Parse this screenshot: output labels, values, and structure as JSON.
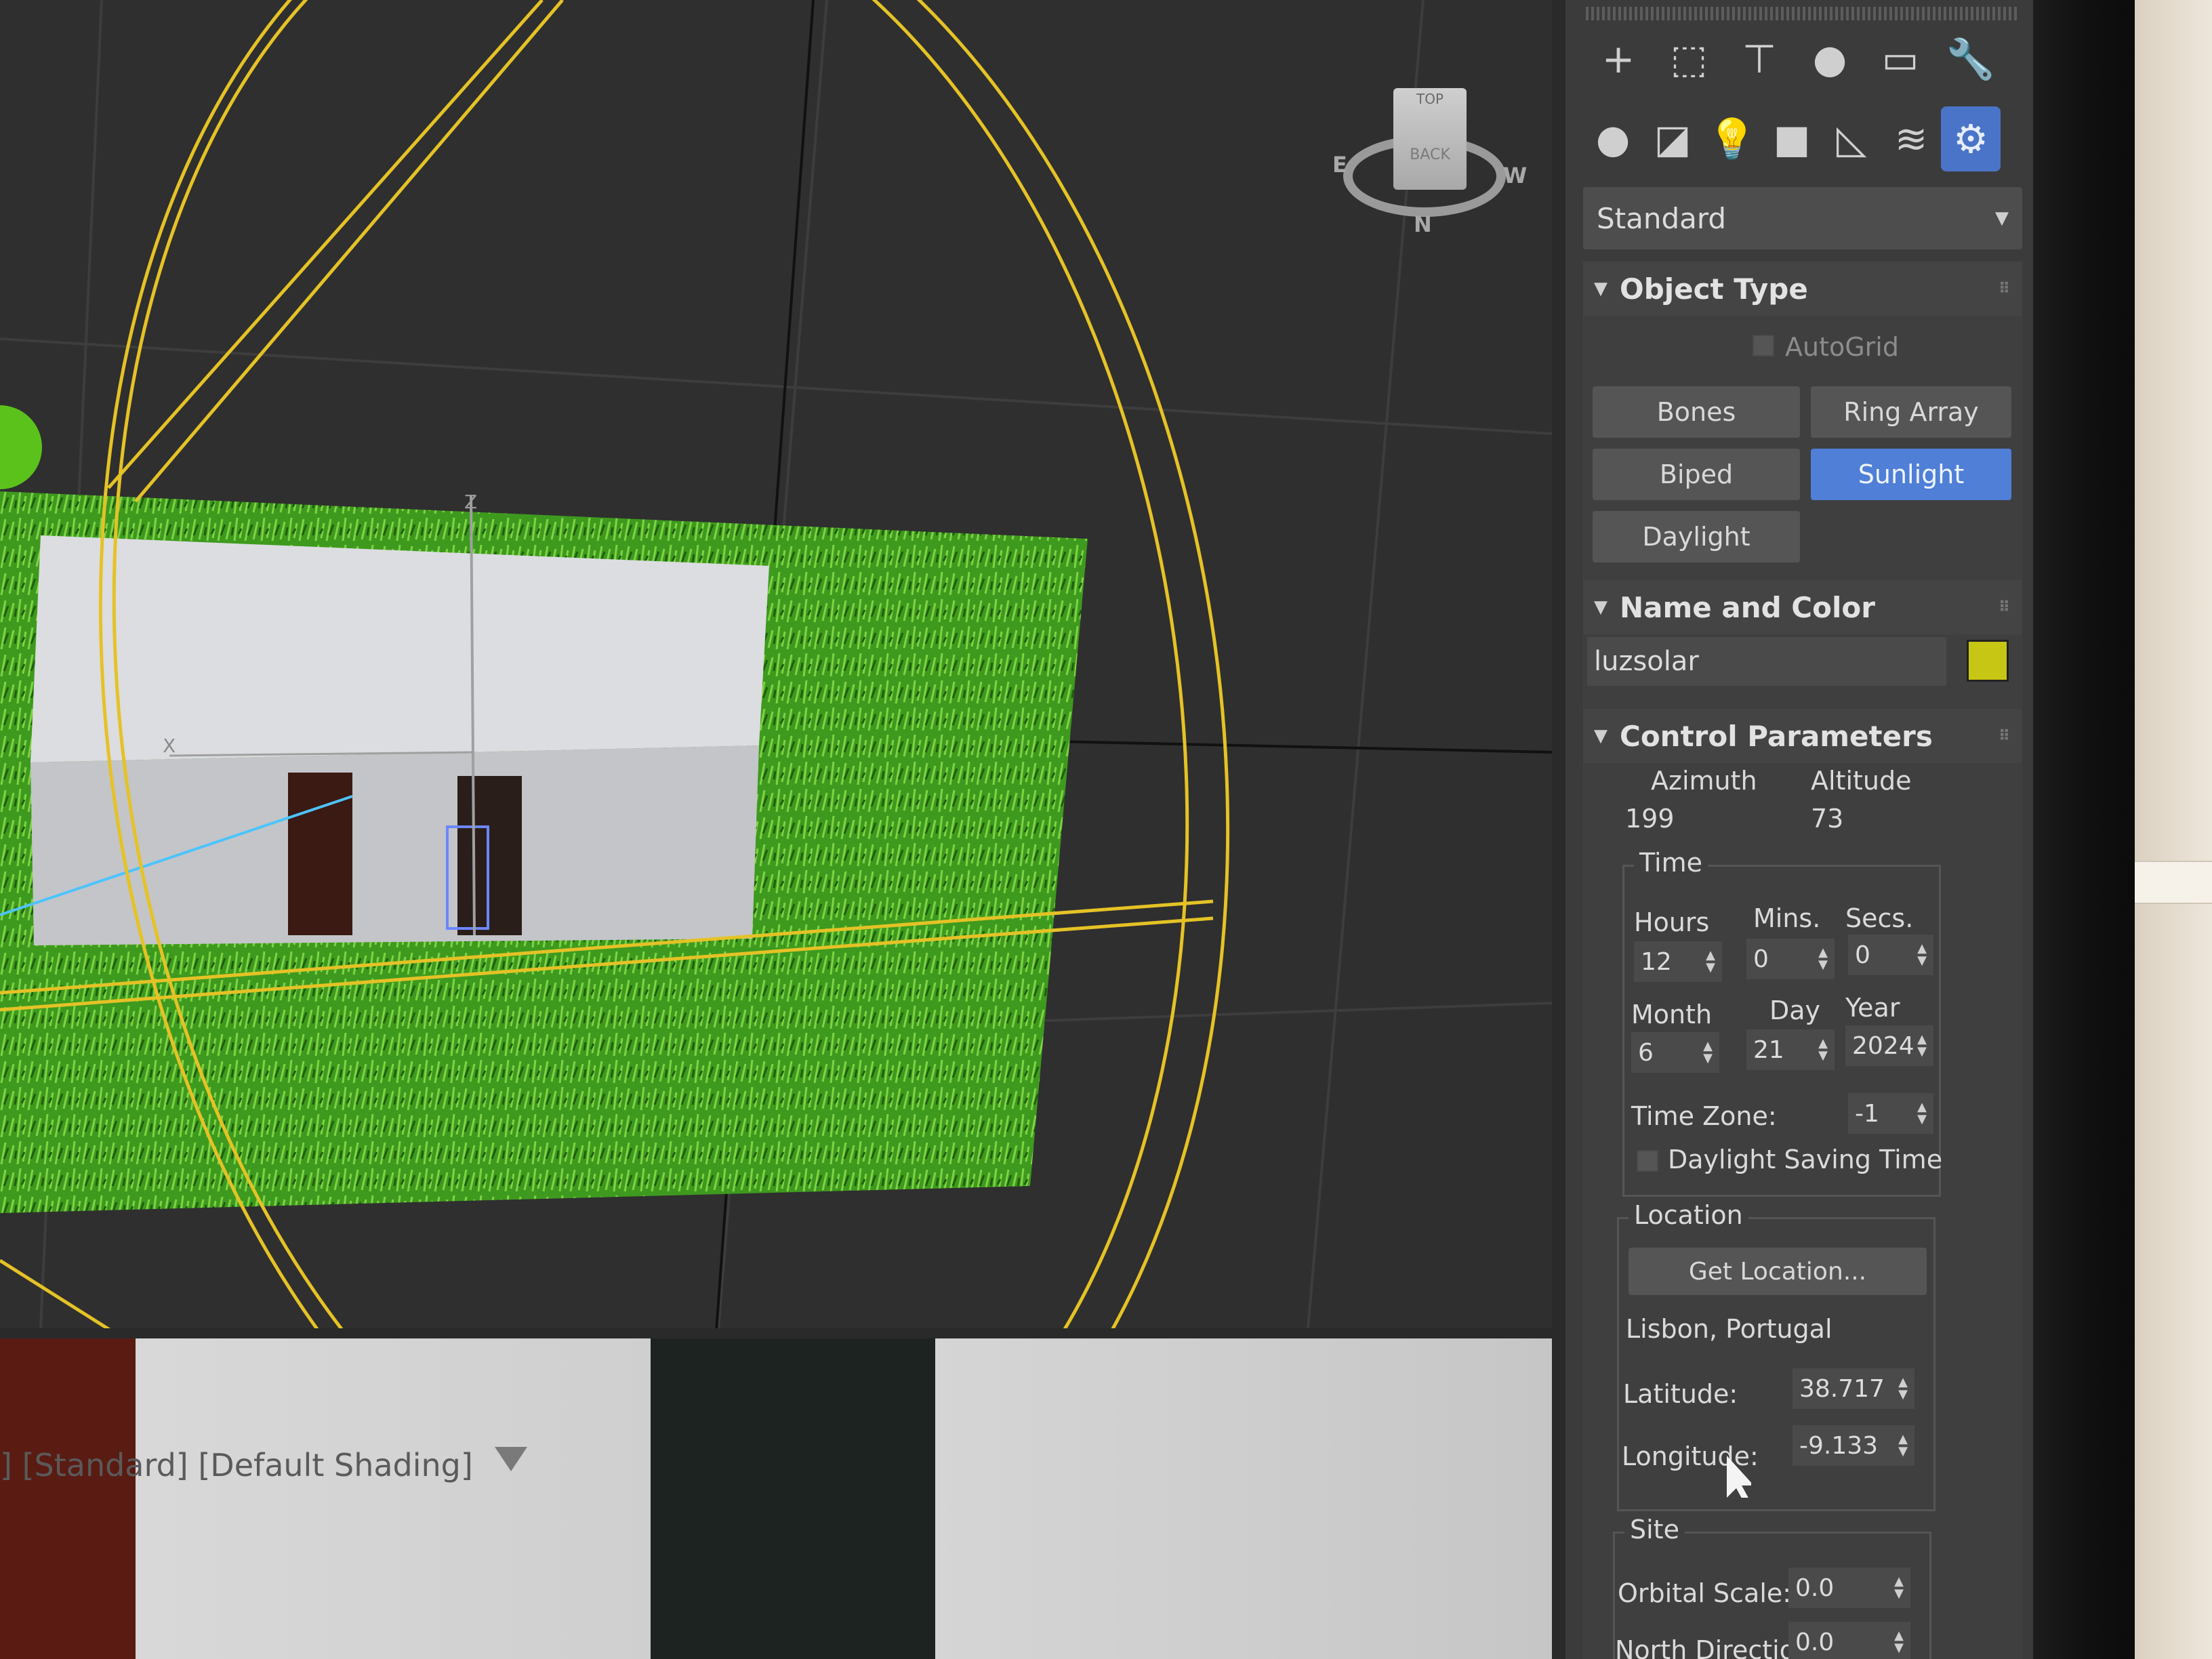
{
  "viewport": {
    "axis_z": "Z",
    "axis_x": "X",
    "viewcube": {
      "top_label": "TOP",
      "front_label": "BACK",
      "north": "N",
      "west": "W",
      "east": "E"
    },
    "bottom_label": "] [Standard] [Default Shading]"
  },
  "toolbar": {
    "tabs": [
      {
        "icon": "plus-icon",
        "glyph": "+"
      },
      {
        "icon": "modify-icon",
        "glyph": "⬚"
      },
      {
        "icon": "hierarchy-icon",
        "glyph": "⊤"
      },
      {
        "icon": "motion-icon",
        "glyph": "●"
      },
      {
        "icon": "display-icon",
        "glyph": "▭"
      },
      {
        "icon": "utilities-icon",
        "glyph": "🔧"
      }
    ],
    "categories": [
      {
        "icon": "geometry-icon",
        "glyph": "●"
      },
      {
        "icon": "shapes-icon",
        "glyph": "◪"
      },
      {
        "icon": "lights-icon",
        "glyph": "💡"
      },
      {
        "icon": "cameras-icon",
        "glyph": "■"
      },
      {
        "icon": "helpers-icon",
        "glyph": "◺"
      },
      {
        "icon": "spacewarps-icon",
        "glyph": "≋"
      },
      {
        "icon": "systems-icon",
        "glyph": "⚙"
      }
    ],
    "active_category": "systems-icon"
  },
  "dropdown": {
    "value": "Standard"
  },
  "object_type": {
    "title": "Object Type",
    "autogrid": "AutoGrid",
    "buttons": [
      "Bones",
      "Ring Array",
      "Biped",
      "Sunlight",
      "Daylight"
    ],
    "active": "Sunlight"
  },
  "name_color": {
    "title": "Name and Color",
    "name": "luzsolar",
    "color": "#c8c614"
  },
  "control": {
    "title": "Control Parameters",
    "azimuth_label": "Azimuth",
    "altitude_label": "Altitude",
    "azimuth": "199",
    "altitude": "73",
    "time": {
      "title": "Time",
      "hours_label": "Hours",
      "mins_label": "Mins.",
      "secs_label": "Secs.",
      "hours": "12",
      "mins": "0",
      "secs": "0",
      "month_label": "Month",
      "day_label": "Day",
      "year_label": "Year",
      "month": "6",
      "day": "21",
      "year": "2024",
      "timezone_label": "Time Zone:",
      "timezone": "-1",
      "dst_label": "Daylight Saving Time"
    },
    "location": {
      "title": "Location",
      "get_location": "Get Location...",
      "city": "Lisbon, Portugal",
      "latitude_label": "Latitude:",
      "latitude": "38.717",
      "longitude_label": "Longitude:",
      "longitude": "-9.133"
    },
    "site": {
      "title": "Site",
      "orbital_label": "Orbital Scale:",
      "orbital": "0.0",
      "north_label": "North Direction:",
      "north": "0.0"
    }
  }
}
